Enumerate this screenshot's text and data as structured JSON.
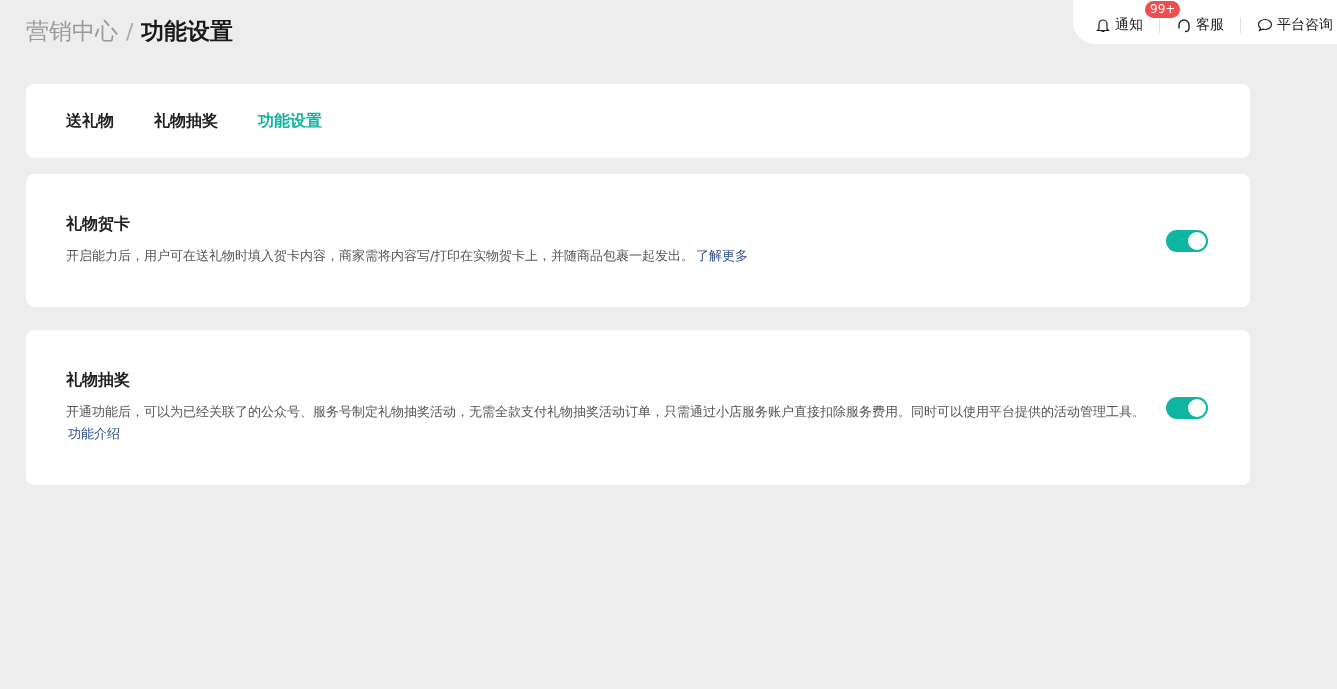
{
  "breadcrumb": {
    "parent": "营销中心",
    "separator": "/",
    "current": "功能设置"
  },
  "header_actions": [
    {
      "kind": "notify",
      "label": "通知",
      "badge": "99+"
    },
    {
      "kind": "service",
      "label": "客服"
    },
    {
      "kind": "consult",
      "label": "平台咨询"
    }
  ],
  "tabs": [
    {
      "label": "送礼物",
      "selected": false
    },
    {
      "label": "礼物抽奖",
      "selected": false
    },
    {
      "label": "功能设置",
      "selected": true
    }
  ],
  "settings": [
    {
      "title": "礼物贺卡",
      "description": "开启能力后，用户可在送礼物时填入贺卡内容，商家需将内容写/打印在实物贺卡上，并随商品包裹一起发出。",
      "link": "了解更多",
      "on": true
    },
    {
      "title": "礼物抽奖",
      "description": "开通功能后，可以为已经关联了的公众号、服务号制定礼物抽奖活动，无需全款支付礼物抽奖活动订单，只需通过小店服务账户直接扣除服务费用。同时可以使用平台提供的活动管理工具。",
      "link": "功能介绍",
      "on": true
    }
  ]
}
